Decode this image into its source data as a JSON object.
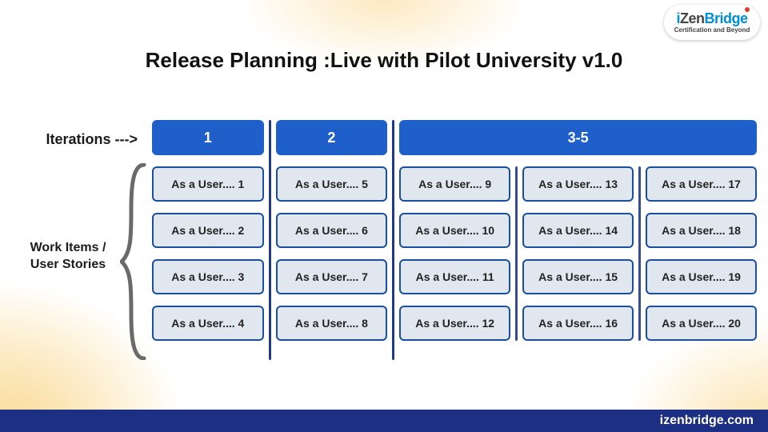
{
  "brand": {
    "name_i": "i",
    "name_zen": "Zen",
    "name_bridge": "Bridge",
    "tagline": "Certification and Beyond"
  },
  "title": "Release Planning :Live with Pilot University v1.0",
  "labels": {
    "iterations": "Iterations --->",
    "work_items_line1": "Work Items /",
    "work_items_line2": "User Stories"
  },
  "columns": [
    {
      "header": "1",
      "cards": [
        "As a User.... 1",
        "As a User.... 2",
        "As a User.... 3",
        "As a User.... 4"
      ]
    },
    {
      "header": "2",
      "cards": [
        "As a User.... 5",
        "As a User.... 6",
        "As a User.... 7",
        "As a User.... 8"
      ]
    }
  ],
  "group": {
    "header": "3-5",
    "columns": [
      {
        "cards": [
          "As a User.... 9",
          "As a User.... 10",
          "As a User.... 11",
          "As a User.... 12"
        ]
      },
      {
        "cards": [
          "As a User.... 13",
          "As a User.... 14",
          "As a User.... 15",
          "As a User.... 16"
        ]
      },
      {
        "cards": [
          "As a User.... 17",
          "As a User.... 18",
          "As a User.... 19",
          "As a User.... 20"
        ]
      }
    ]
  },
  "footer": "izenbridge.com",
  "colors": {
    "accent_blue": "#1f5fc9",
    "footer_navy": "#1c2f82",
    "card_bg": "#e0e7ee",
    "card_border": "#1a4fa0"
  }
}
